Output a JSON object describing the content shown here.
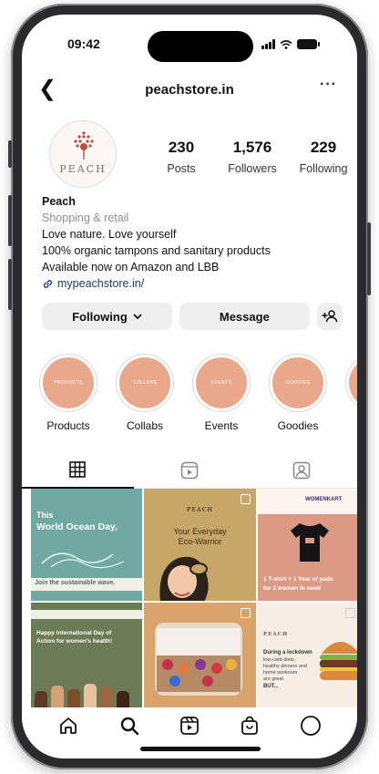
{
  "status": {
    "time": "09:42"
  },
  "header": {
    "handle": "peachstore.in",
    "back_icon": "back-arrow-icon",
    "more_label": "···"
  },
  "profile": {
    "avatar_brand": "PEACH",
    "stats": [
      {
        "value": "230",
        "label": "Posts"
      },
      {
        "value": "1,576",
        "label": "Followers"
      },
      {
        "value": "229",
        "label": "Following"
      }
    ],
    "name": "Peach",
    "category": "Shopping & retail",
    "bio_lines": [
      "Love nature. Love yourself",
      "100% organic tampons and sanitary products",
      "Available now on Amazon and LBB"
    ],
    "link": "mypeachstore.in/"
  },
  "actions": {
    "following_label": "Following",
    "message_label": "Message"
  },
  "highlights": [
    {
      "label": "Products",
      "cover_text": "PRODUCTS"
    },
    {
      "label": "Collabs",
      "cover_text": "COLLABS"
    },
    {
      "label": "Events",
      "cover_text": "EVENTS"
    },
    {
      "label": "Goodies",
      "cover_text": "GOODIES"
    }
  ],
  "posts": {
    "p1": {
      "line1": "This",
      "line2": "World Ocean Day,",
      "line3": "Join the sustainable wave."
    },
    "p2": {
      "brand": "PEACH",
      "line1": "Your Everyday",
      "line2": "Eco-Warrior"
    },
    "p3": {
      "brand": "WOMENKART",
      "line1": "1 T-shirt = 1 Year of pads",
      "line2": "for 2 women in need"
    },
    "p4": {
      "line1": "Happy International Day of",
      "line2": "Action for women's health!"
    },
    "p6": {
      "brand": "PEACH",
      "line1": "During a lockdown",
      "line2": "low-carb diets,",
      "line3": "healthy dinners and",
      "line4": "home workouts",
      "line5": "are great",
      "line6": "BUT..."
    }
  },
  "colors": {
    "highlight": "#e9a88b",
    "accent_link": "#1d3b6b"
  }
}
